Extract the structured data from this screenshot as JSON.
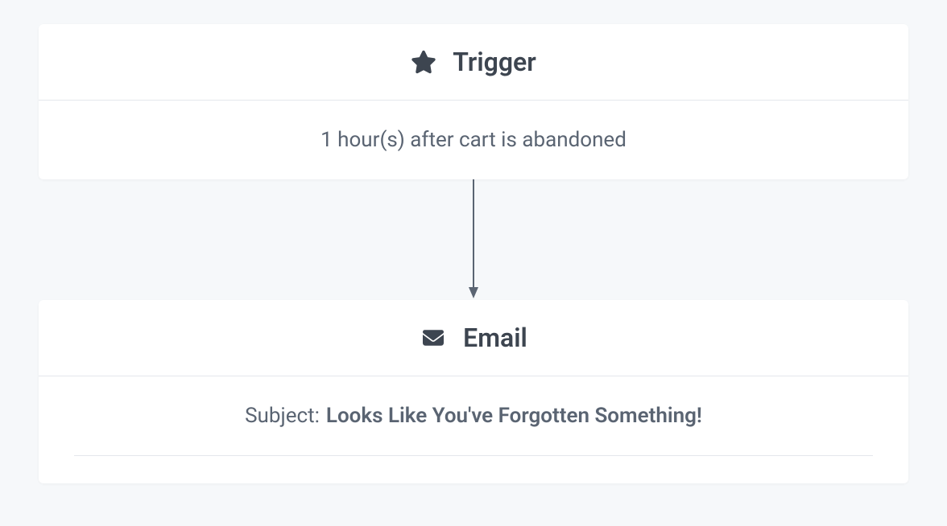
{
  "trigger": {
    "title": "Trigger",
    "description": "1 hour(s) after cart is abandoned"
  },
  "email": {
    "title": "Email",
    "subject_label": "Subject:",
    "subject_value": "Looks Like You've Forgotten Something!"
  },
  "colors": {
    "icon": "#3d4550",
    "text_primary": "#3d4550",
    "text_secondary": "#5a6472",
    "border": "#e4e7ec",
    "bg": "#f6f8fa"
  }
}
